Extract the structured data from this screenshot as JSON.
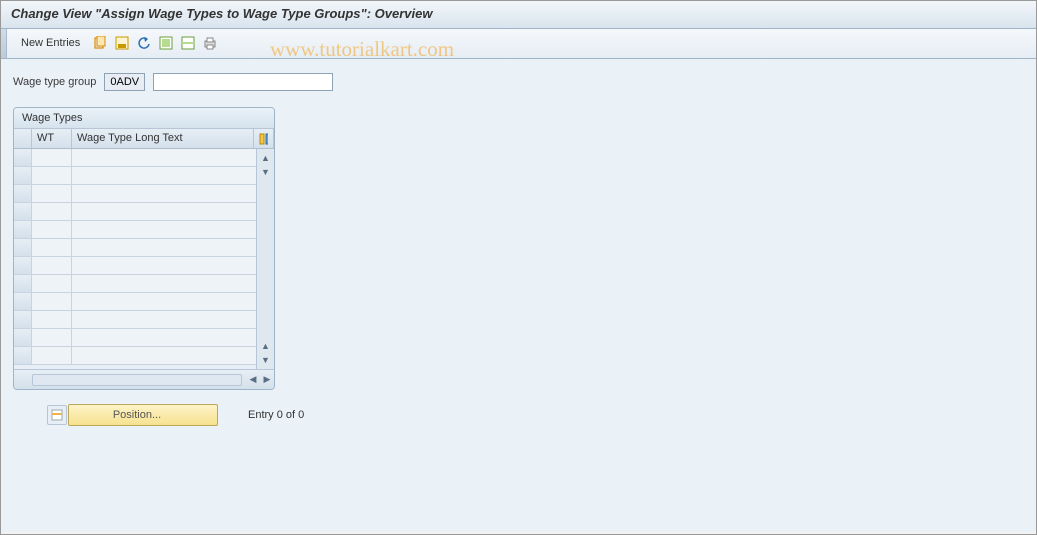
{
  "header": {
    "title": "Change View \"Assign Wage Types to Wage Type Groups\": Overview"
  },
  "toolbar": {
    "new_entries_label": "New Entries"
  },
  "fields": {
    "wage_type_group_label": "Wage type group",
    "wage_type_group_code": "0ADV",
    "wage_type_group_desc": ""
  },
  "panel": {
    "title": "Wage Types",
    "columns": {
      "wt": "WT",
      "long_text": "Wage Type Long Text"
    },
    "rows": [
      {
        "wt": "",
        "text": ""
      },
      {
        "wt": "",
        "text": ""
      },
      {
        "wt": "",
        "text": ""
      },
      {
        "wt": "",
        "text": ""
      },
      {
        "wt": "",
        "text": ""
      },
      {
        "wt": "",
        "text": ""
      },
      {
        "wt": "",
        "text": ""
      },
      {
        "wt": "",
        "text": ""
      },
      {
        "wt": "",
        "text": ""
      },
      {
        "wt": "",
        "text": ""
      },
      {
        "wt": "",
        "text": ""
      },
      {
        "wt": "",
        "text": ""
      }
    ]
  },
  "footer": {
    "position_label": "Position...",
    "entry_text": "Entry 0 of 0"
  },
  "watermark": "www.tutorialkart.com"
}
